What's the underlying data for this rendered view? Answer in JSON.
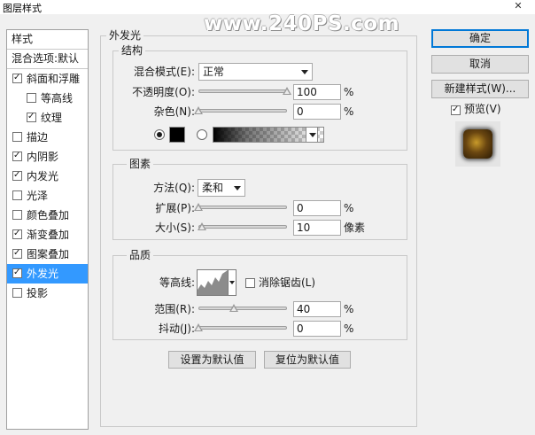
{
  "window": {
    "title": "图层样式",
    "close_glyph": "✕",
    "watermark": "www.240PS.com"
  },
  "sidebar": {
    "header_styles": "样式",
    "header_blend": "混合选项:默认",
    "items": [
      {
        "label": "斜面和浮雕",
        "checked": true,
        "indent": false
      },
      {
        "label": "等高线",
        "checked": false,
        "indent": true
      },
      {
        "label": "纹理",
        "checked": true,
        "indent": true
      },
      {
        "label": "描边",
        "checked": false,
        "indent": false
      },
      {
        "label": "内阴影",
        "checked": true,
        "indent": false
      },
      {
        "label": "内发光",
        "checked": true,
        "indent": false
      },
      {
        "label": "光泽",
        "checked": false,
        "indent": false
      },
      {
        "label": "颜色叠加",
        "checked": false,
        "indent": false
      },
      {
        "label": "渐变叠加",
        "checked": true,
        "indent": false
      },
      {
        "label": "图案叠加",
        "checked": true,
        "indent": false
      },
      {
        "label": "外发光",
        "checked": true,
        "indent": false,
        "selected": true
      },
      {
        "label": "投影",
        "checked": false,
        "indent": false
      }
    ]
  },
  "panel": {
    "title": "外发光",
    "structure": {
      "legend": "结构",
      "blend_mode_label": "混合模式(E):",
      "blend_mode_value": "正常",
      "opacity_label": "不透明度(O):",
      "opacity_value": "100",
      "opacity_unit": "%",
      "opacity_level": 1.0,
      "noise_label": "杂色(N):",
      "noise_value": "0",
      "noise_unit": "%",
      "noise_level": 0.0,
      "color_radio_selected": true,
      "gradient_radio_selected": false
    },
    "elements": {
      "legend": "图素",
      "technique_label": "方法(Q):",
      "technique_value": "柔和",
      "spread_label": "扩展(P):",
      "spread_value": "0",
      "spread_unit": "%",
      "spread_level": 0.0,
      "size_label": "大小(S):",
      "size_value": "10",
      "size_unit": "像素",
      "size_level": 0.04
    },
    "quality": {
      "legend": "品质",
      "contour_label": "等高线:",
      "antialias_label": "消除锯齿(L)",
      "antialias_checked": false,
      "range_label": "范围(R):",
      "range_value": "40",
      "range_unit": "%",
      "range_level": 0.4,
      "jitter_label": "抖动(J):",
      "jitter_value": "0",
      "jitter_unit": "%",
      "jitter_level": 0.0
    },
    "make_default_label": "设置为默认值",
    "reset_default_label": "复位为默认值"
  },
  "actions": {
    "ok_label": "确定",
    "cancel_label": "取消",
    "new_style_label": "新建样式(W)...",
    "preview_label": "预览(V)",
    "preview_checked": true
  },
  "colors": {
    "selection": "#3399ff",
    "glow_color": "#000000"
  }
}
